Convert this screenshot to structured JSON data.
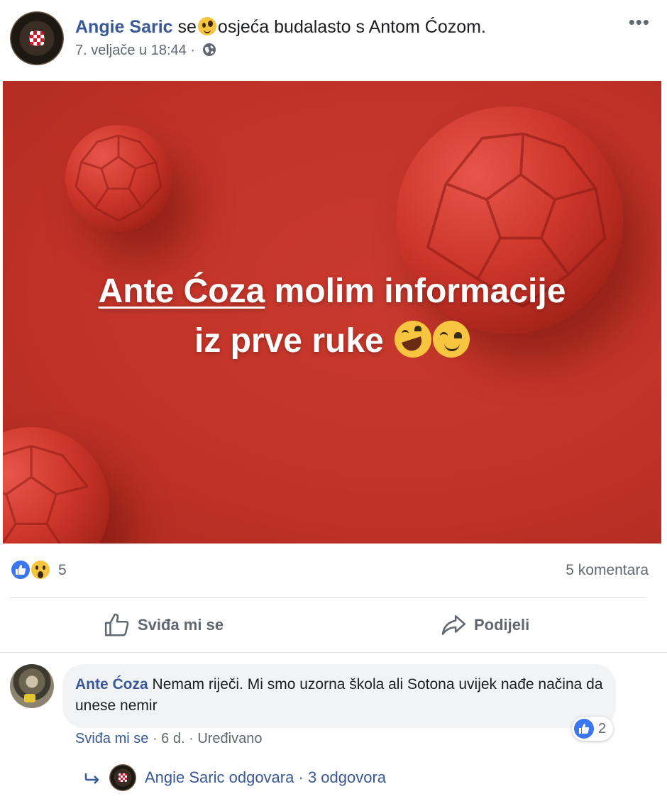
{
  "post": {
    "author": "Angie Saric",
    "feeling_prefix": "se",
    "feeling_text": "osjeća budalasto s",
    "tagged_person": "Antom Ćozom",
    "feeling_suffix": ".",
    "feeling_icon": "silly-face-emoji",
    "date": "7. veljače u 18:44",
    "separator": "·",
    "privacy_icon": "globe-icon",
    "more_label": "•••"
  },
  "image": {
    "mention": "Ante Ćoza",
    "line1_rest": " molim informacije",
    "line2": "iz prve ruke ",
    "emojis": [
      "rofl-emoji",
      "yum-emoji"
    ],
    "background_color": "#c13328"
  },
  "reactions": {
    "types": [
      "like",
      "wow"
    ],
    "count": "5",
    "comments_label": "5 komentara"
  },
  "actions": {
    "like_label": "Sviđa mi se",
    "share_label": "Podijeli"
  },
  "comment": {
    "author": "Ante Ćoza",
    "text": "Nemam riječi. Mi smo uzorna škola ali Sotona uvijek nađe načina da unese nemir",
    "reaction_count": "2",
    "like_label": "Sviđa mi se",
    "age": "6 d.",
    "edited_label": "Uređivano",
    "separator": "·"
  },
  "reply": {
    "text": "Angie Saric odgovara",
    "separator": "·",
    "count_label": "3 odgovora"
  },
  "colors": {
    "link_blue": "#385898",
    "like_blue": "#3b77f0",
    "muted_text": "#606770"
  }
}
